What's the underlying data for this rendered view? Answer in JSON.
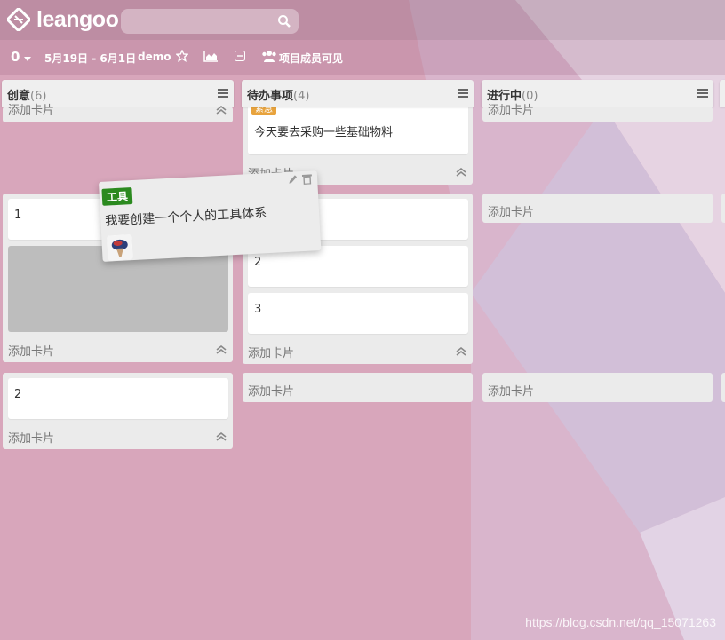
{
  "app": {
    "logo_text": "leangoo"
  },
  "search": {
    "placeholder": ""
  },
  "board_bar": {
    "counter": "0",
    "date_range": "5月19日 - 6月1日",
    "board_name": "demo",
    "visibility": "项目成员可见"
  },
  "lists": [
    {
      "title": "创意",
      "count": "(6)",
      "groups": [
        {
          "add_label": "添加卡片",
          "cards": []
        },
        {
          "add_label": "添加卡片",
          "cards": [
            "1"
          ]
        },
        {
          "add_label": "添加卡片",
          "cards": [
            "2"
          ]
        }
      ]
    },
    {
      "title": "待办事项",
      "count": "(4)",
      "tag": "紧急",
      "groups": [
        {
          "add_label": "添加卡片",
          "cards": [
            "今天要去采购一些基础物料"
          ]
        },
        {
          "add_label": "添加卡片",
          "cards": [
            "",
            "2",
            "3"
          ]
        },
        {
          "add_label": "添加卡片",
          "cards": []
        }
      ]
    },
    {
      "title": "进行中",
      "count": "(0)",
      "groups": [
        {
          "add_label": "添加卡片",
          "cards": []
        },
        {
          "add_label": "添加卡片",
          "cards": []
        },
        {
          "add_label": "添加卡片",
          "cards": []
        }
      ]
    }
  ],
  "dragged_card": {
    "label": "工具",
    "text": "我要创建一个个人的工具体系"
  },
  "watermark": "https://blog.csdn.net/qq_15071263",
  "colors": {
    "tag_label": "#2b8a1f",
    "tag_urgent": "#e8a33d"
  }
}
